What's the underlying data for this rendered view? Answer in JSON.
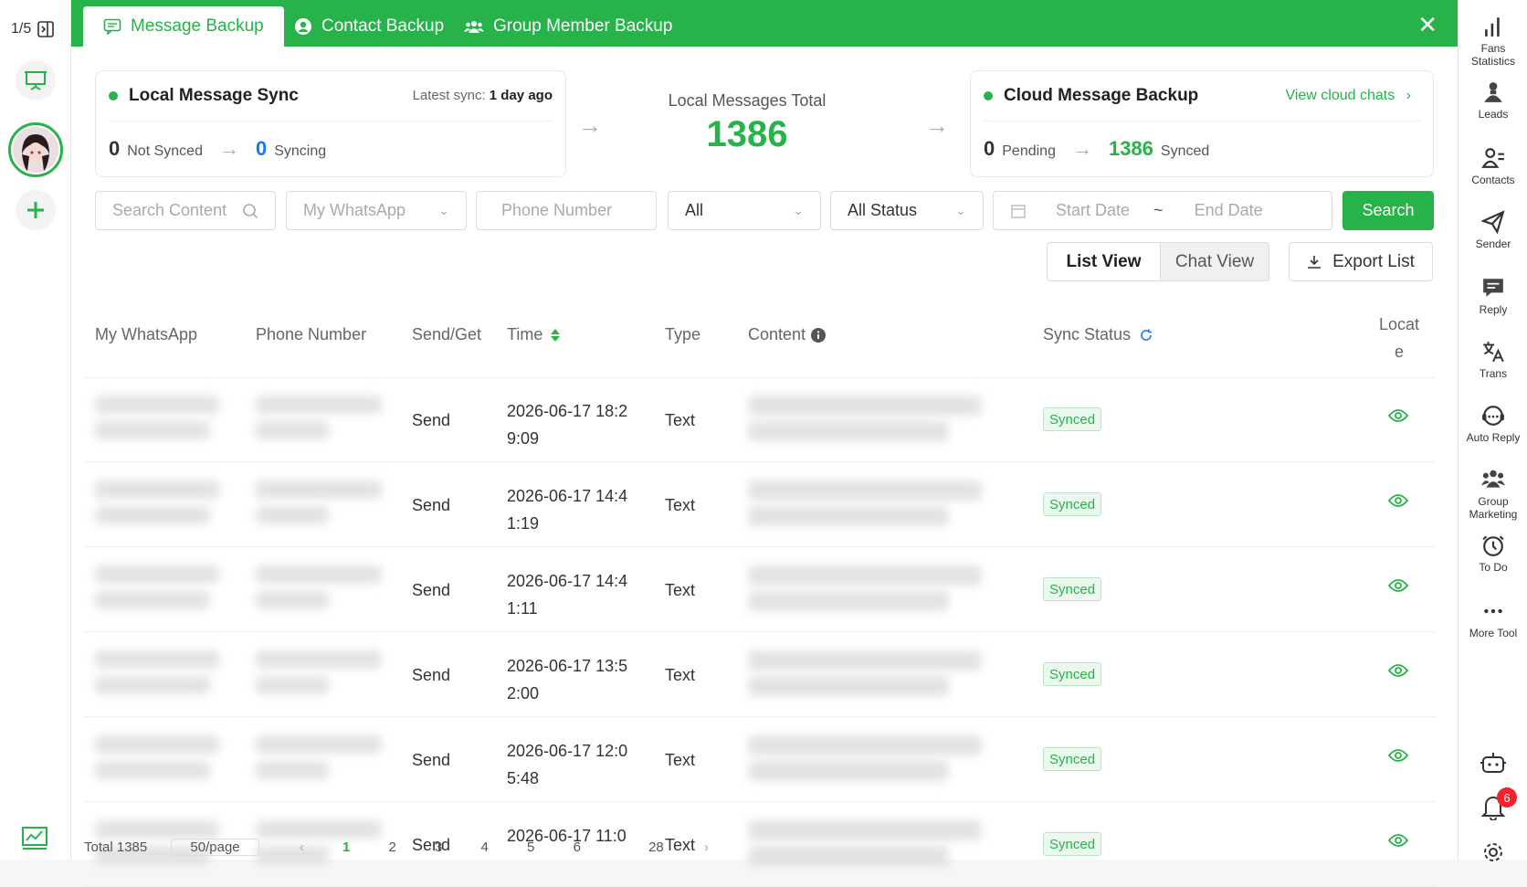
{
  "left_rail": {
    "page_counter": "1/5"
  },
  "tabs": [
    {
      "label": "Message Backup"
    },
    {
      "label": "Contact Backup"
    },
    {
      "label": "Group Member Backup"
    }
  ],
  "local_sync": {
    "title": "Local Message Sync",
    "latest_label": "Latest sync:",
    "latest_value": "1 day ago",
    "not_synced_count": "0",
    "not_synced_label": "Not Synced",
    "syncing_count": "0",
    "syncing_label": "Syncing"
  },
  "total": {
    "label": "Local Messages Total",
    "value": "1386"
  },
  "cloud": {
    "title": "Cloud Message Backup",
    "link": "View cloud chats",
    "pending_count": "0",
    "pending_label": "Pending",
    "synced_count": "1386",
    "synced_label": "Synced"
  },
  "filters": {
    "search_placeholder": "Search Content",
    "whatsapp_placeholder": "My WhatsApp",
    "phone_placeholder": "Phone Number",
    "type_value": "All",
    "status_value": "All Status",
    "start_date": "Start Date",
    "date_sep": "~",
    "end_date": "End Date",
    "search_button": "Search"
  },
  "views": {
    "list": "List View",
    "chat": "Chat View",
    "export": "Export List"
  },
  "columns": {
    "my_whatsapp": "My WhatsApp",
    "phone": "Phone Number",
    "send_get": "Send/Get",
    "time": "Time",
    "type": "Type",
    "content": "Content",
    "sync_status": "Sync Status",
    "locate_1": "Locat",
    "locate_2": "e"
  },
  "rows": [
    {
      "send": "Send",
      "time1": "2026-06-17 18:2",
      "time2": "9:09",
      "type": "Text",
      "status": "Synced"
    },
    {
      "send": "Send",
      "time1": "2026-06-17 14:4",
      "time2": "1:19",
      "type": "Text",
      "status": "Synced"
    },
    {
      "send": "Send",
      "time1": "2026-06-17 14:4",
      "time2": "1:11",
      "type": "Text",
      "status": "Synced"
    },
    {
      "send": "Send",
      "time1": "2026-06-17 13:5",
      "time2": "2:00",
      "type": "Text",
      "status": "Synced"
    },
    {
      "send": "Send",
      "time1": "2026-06-17 12:0",
      "time2": "5:48",
      "type": "Text",
      "status": "Synced"
    },
    {
      "send": "Send",
      "time1": "2026-06-17 11:0",
      "time2": "",
      "type": "Text",
      "status": "Synced"
    }
  ],
  "footer": {
    "total": "Total 1385",
    "per_page": "50/page",
    "pages": [
      "1",
      "2",
      "3",
      "4",
      "5",
      "6",
      "28"
    ]
  },
  "right_rail": [
    {
      "label1": "Fans",
      "label2": "Statistics",
      "icon": "bar-chart-icon"
    },
    {
      "label1": "Leads",
      "label2": "",
      "icon": "user-icon"
    },
    {
      "label1": "Contacts",
      "label2": "",
      "icon": "contacts-icon"
    },
    {
      "label1": "Sender",
      "label2": "",
      "icon": "paper-plane-icon"
    },
    {
      "label1": "Reply",
      "label2": "",
      "icon": "reply-icon"
    },
    {
      "label1": "Trans",
      "label2": "",
      "icon": "translate-icon"
    },
    {
      "label1": "Auto Reply",
      "label2": "",
      "icon": "headset-icon"
    },
    {
      "label1": "Group",
      "label2": "Marketing",
      "icon": "group-icon"
    },
    {
      "label1": "To Do",
      "label2": "",
      "icon": "clock-icon"
    },
    {
      "label1": "More Tool",
      "label2": "",
      "icon": "more-icon"
    }
  ],
  "notification_count": "6",
  "colors": {
    "brand": "#27b24a",
    "syncing_blue": "#1677ff",
    "badge_red": "#f5222d"
  }
}
